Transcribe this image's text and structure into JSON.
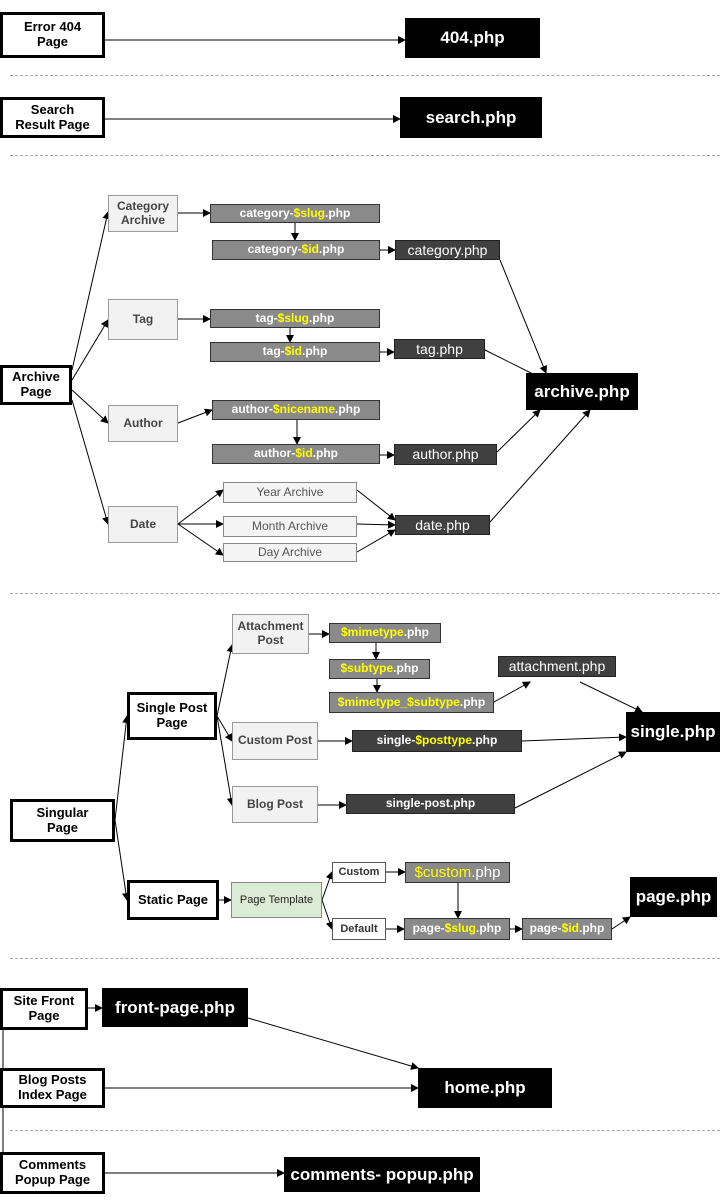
{
  "colors": {
    "highlight": "#ffff00",
    "final_template": "#000000",
    "dark_template": "#404040",
    "template": "#8a8a8a",
    "condition": "#f2f2f2",
    "page_template": "#dcebd5"
  },
  "boxes": [
    {
      "id": "error-404-page",
      "kind": "page",
      "lines": [
        [
          {
            "t": "Error 404"
          }
        ],
        [
          {
            "t": "Page"
          }
        ]
      ]
    },
    {
      "id": "404-php",
      "kind": "final",
      "lines": [
        [
          {
            "t": "404.php"
          }
        ]
      ]
    },
    {
      "id": "search-result-page",
      "kind": "page",
      "lines": [
        [
          {
            "t": "Search"
          }
        ],
        [
          {
            "t": "Result Page"
          }
        ]
      ]
    },
    {
      "id": "search-php",
      "kind": "final",
      "lines": [
        [
          {
            "t": "search.php"
          }
        ]
      ]
    },
    {
      "id": "archive-page",
      "kind": "page",
      "lines": [
        [
          {
            "t": "Archive"
          }
        ],
        [
          {
            "t": "Page"
          }
        ]
      ]
    },
    {
      "id": "category-archive",
      "kind": "cond",
      "lines": [
        [
          {
            "t": "Category"
          }
        ],
        [
          {
            "t": "Archive"
          }
        ]
      ]
    },
    {
      "id": "category-slug-php",
      "kind": "tpl",
      "lines": [
        [
          {
            "t": "category-"
          },
          {
            "t": "$slug",
            "hl": true
          },
          {
            "t": ".php"
          }
        ]
      ]
    },
    {
      "id": "category-id-php",
      "kind": "tpl",
      "lines": [
        [
          {
            "t": "category-"
          },
          {
            "t": "$id",
            "hl": true
          },
          {
            "t": ".php"
          }
        ]
      ]
    },
    {
      "id": "category-php",
      "kind": "tpl2",
      "lines": [
        [
          {
            "t": "category.php"
          }
        ]
      ]
    },
    {
      "id": "tag",
      "kind": "cond",
      "lines": [
        [
          {
            "t": "Tag"
          }
        ]
      ]
    },
    {
      "id": "tag-slug-php",
      "kind": "tpl",
      "lines": [
        [
          {
            "t": "tag-"
          },
          {
            "t": "$slug",
            "hl": true
          },
          {
            "t": ".php"
          }
        ]
      ]
    },
    {
      "id": "tag-id-php",
      "kind": "tpl",
      "lines": [
        [
          {
            "t": "tag-"
          },
          {
            "t": "$id",
            "hl": true
          },
          {
            "t": ".php"
          }
        ]
      ]
    },
    {
      "id": "tag-php",
      "kind": "tpl2",
      "lines": [
        [
          {
            "t": "tag.php"
          }
        ]
      ]
    },
    {
      "id": "archive-php",
      "kind": "final",
      "lines": [
        [
          {
            "t": "archive.php"
          }
        ]
      ]
    },
    {
      "id": "author",
      "kind": "cond",
      "lines": [
        [
          {
            "t": "Author"
          }
        ]
      ]
    },
    {
      "id": "author-nicename-php",
      "kind": "tpl",
      "lines": [
        [
          {
            "t": "author-"
          },
          {
            "t": "$nicename",
            "hl": true
          },
          {
            "t": ".php"
          }
        ]
      ]
    },
    {
      "id": "author-id-php",
      "kind": "tpl",
      "lines": [
        [
          {
            "t": "author-"
          },
          {
            "t": "$id",
            "hl": true
          },
          {
            "t": ".php"
          }
        ]
      ]
    },
    {
      "id": "author-php",
      "kind": "tpl2",
      "lines": [
        [
          {
            "t": "author.php"
          }
        ]
      ]
    },
    {
      "id": "date",
      "kind": "cond",
      "lines": [
        [
          {
            "t": "Date"
          }
        ]
      ]
    },
    {
      "id": "year-archive",
      "kind": "sub",
      "lines": [
        [
          {
            "t": "Year Archive"
          }
        ]
      ]
    },
    {
      "id": "month-archive",
      "kind": "sub",
      "lines": [
        [
          {
            "t": "Month Archive"
          }
        ]
      ]
    },
    {
      "id": "day-archive",
      "kind": "sub",
      "lines": [
        [
          {
            "t": "Day Archive"
          }
        ]
      ]
    },
    {
      "id": "date-php",
      "kind": "tpl2",
      "lines": [
        [
          {
            "t": "date.php"
          }
        ]
      ]
    },
    {
      "id": "singular-page",
      "kind": "page",
      "lines": [
        [
          {
            "t": "Singular"
          }
        ],
        [
          {
            "t": "Page"
          }
        ]
      ]
    },
    {
      "id": "single-post-page",
      "kind": "page",
      "lines": [
        [
          {
            "t": "Single Post"
          }
        ],
        [
          {
            "t": "Page"
          }
        ]
      ]
    },
    {
      "id": "attachment-post",
      "kind": "cond",
      "lines": [
        [
          {
            "t": "Attachment"
          }
        ],
        [
          {
            "t": "Post"
          }
        ]
      ]
    },
    {
      "id": "mimetype-php",
      "kind": "tpl",
      "lines": [
        [
          {
            "t": "$mimetype",
            "hl": true
          },
          {
            "t": ".php"
          }
        ]
      ]
    },
    {
      "id": "subtype-php",
      "kind": "tpl",
      "lines": [
        [
          {
            "t": "$subtype",
            "hl": true
          },
          {
            "t": ".php"
          }
        ]
      ]
    },
    {
      "id": "mimetype-subtype-php",
      "kind": "tpl",
      "lines": [
        [
          {
            "t": "$mimetype_$subtype",
            "hl": true
          },
          {
            "t": ".php"
          }
        ]
      ]
    },
    {
      "id": "attachment-php",
      "kind": "tpl2",
      "lines": [
        [
          {
            "t": "attachment.php"
          }
        ]
      ]
    },
    {
      "id": "single-php",
      "kind": "final",
      "lines": [
        [
          {
            "t": "single.php"
          }
        ]
      ]
    },
    {
      "id": "custom-post",
      "kind": "cond",
      "lines": [
        [
          {
            "t": "Custom Post"
          }
        ]
      ]
    },
    {
      "id": "single-posttype-php",
      "kind": "tpl2s",
      "lines": [
        [
          {
            "t": "single-"
          },
          {
            "t": "$posttype",
            "hl": true
          },
          {
            "t": ".php"
          }
        ]
      ]
    },
    {
      "id": "blog-post",
      "kind": "cond",
      "lines": [
        [
          {
            "t": "Blog Post"
          }
        ]
      ]
    },
    {
      "id": "single-post-php",
      "kind": "tpl2s",
      "lines": [
        [
          {
            "t": "single-post.php"
          }
        ]
      ]
    },
    {
      "id": "static-page",
      "kind": "page",
      "lines": [
        [
          {
            "t": "Static Page"
          }
        ]
      ]
    },
    {
      "id": "page-template",
      "kind": "green",
      "lines": [
        [
          {
            "t": "Page Template"
          }
        ]
      ]
    },
    {
      "id": "custom",
      "kind": "plain",
      "lines": [
        [
          {
            "t": "Custom"
          }
        ]
      ]
    },
    {
      "id": "custom-php",
      "kind": "tplbig",
      "lines": [
        [
          {
            "t": "$custom",
            "hl": true
          },
          {
            "t": ".php"
          }
        ]
      ]
    },
    {
      "id": "default",
      "kind": "plain",
      "lines": [
        [
          {
            "t": "Default"
          }
        ]
      ]
    },
    {
      "id": "page-slug-php",
      "kind": "tpl",
      "lines": [
        [
          {
            "t": "page-"
          },
          {
            "t": "$slug",
            "hl": true
          },
          {
            "t": ".php"
          }
        ]
      ]
    },
    {
      "id": "page-id-php",
      "kind": "tpl",
      "lines": [
        [
          {
            "t": "page-"
          },
          {
            "t": "$id",
            "hl": true
          },
          {
            "t": ".php"
          }
        ]
      ]
    },
    {
      "id": "page-php",
      "kind": "final",
      "lines": [
        [
          {
            "t": "page.php"
          }
        ]
      ]
    },
    {
      "id": "site-front-page",
      "kind": "page",
      "lines": [
        [
          {
            "t": "Site Front"
          }
        ],
        [
          {
            "t": "Page"
          }
        ]
      ]
    },
    {
      "id": "front-page-php",
      "kind": "final",
      "lines": [
        [
          {
            "t": "front-page.php"
          }
        ]
      ]
    },
    {
      "id": "blog-posts-index-page",
      "kind": "page",
      "lines": [
        [
          {
            "t": "Blog Posts"
          }
        ],
        [
          {
            "t": "Index Page"
          }
        ]
      ]
    },
    {
      "id": "home-php",
      "kind": "final",
      "lines": [
        [
          {
            "t": "home.php"
          }
        ]
      ]
    },
    {
      "id": "comments-popup-page",
      "kind": "page",
      "lines": [
        [
          {
            "t": "Comments"
          }
        ],
        [
          {
            "t": "Popup Page"
          }
        ]
      ]
    },
    {
      "id": "comments-popup-php",
      "kind": "final",
      "lines": [
        [
          {
            "t": "comments- popup.php"
          }
        ]
      ]
    }
  ]
}
